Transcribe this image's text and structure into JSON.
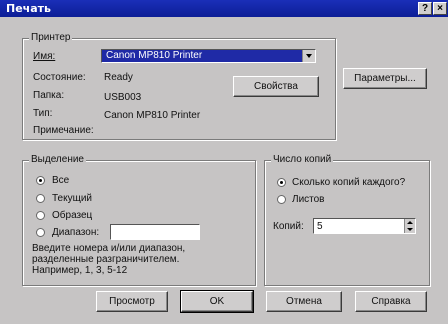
{
  "window": {
    "title": "Печать",
    "help_btn": "?",
    "close_btn": "×"
  },
  "printer": {
    "group_label": "Принтер",
    "name_label": "Имя:",
    "name_value": "Canon MP810 Printer",
    "status_label": "Состояние:",
    "status_value": "Ready",
    "folder_label": "Папка:",
    "folder_value": "USB003",
    "type_label": "Тип:",
    "type_value": "Canon MP810 Printer",
    "comment_label": "Примечание:",
    "properties_btn": "Свойства",
    "params_btn": "Параметры..."
  },
  "selection": {
    "group_label": "Выделение",
    "options": [
      "Все",
      "Текущий",
      "Образец",
      "Диапазон:"
    ],
    "selected_index": 0,
    "range_value": "",
    "help_lines": [
      "Введите номера и/или диапазон,",
      "разделенные разграничителем.",
      "Например, 1, 3, 5-12"
    ]
  },
  "copies": {
    "group_label": "Число копий",
    "options": [
      "Сколько копий каждого?",
      "Листов"
    ],
    "selected_index": 0,
    "copies_label": "Копий:",
    "copies_value": "5"
  },
  "footer": {
    "preview_btn": "Просмотр",
    "ok_btn": "OK",
    "cancel_btn": "Отмена",
    "help_btn": "Справка"
  }
}
